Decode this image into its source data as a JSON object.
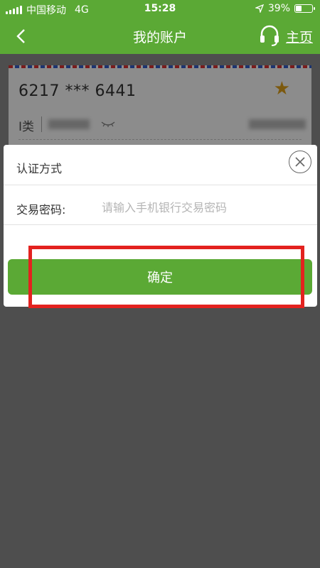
{
  "status_bar": {
    "carrier": "中国移动",
    "network": "4G",
    "time": "15:28",
    "battery_percent": "39%",
    "battery_level": 0.39
  },
  "nav": {
    "title": "我的账户",
    "back_icon": "chevron-left-icon",
    "headset_icon": "headset-icon",
    "home_label": "主页"
  },
  "account_card": {
    "number": "6217 *** 6441",
    "type": "I类",
    "star_icon": "star-icon",
    "eye_icon": "eye-closed-icon"
  },
  "modal": {
    "title": "认证方式",
    "close_icon": "close-icon",
    "password_label": "交易密码:",
    "password_placeholder": "请输入手机银行交易密码",
    "password_value": "",
    "confirm_label": "确定"
  },
  "colors": {
    "brand_green": "#5ba935",
    "star": "#e2a31a",
    "highlight_red": "#e3221f"
  }
}
